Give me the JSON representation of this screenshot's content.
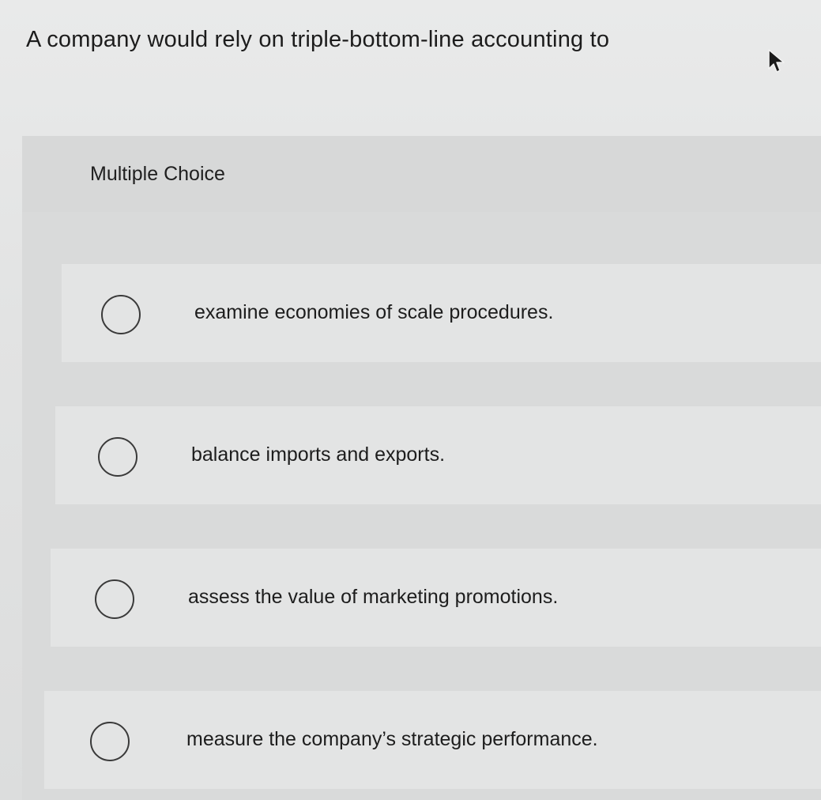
{
  "question": {
    "text": "A company would rely on triple-bottom-line accounting to"
  },
  "section": {
    "label": "Multiple Choice"
  },
  "choices": [
    {
      "label": "examine economies of scale procedures.",
      "selected": false
    },
    {
      "label": "balance imports and exports.",
      "selected": false
    },
    {
      "label": "assess the value of marketing promotions.",
      "selected": false
    },
    {
      "label": "measure the company’s strategic performance.",
      "selected": false
    }
  ],
  "icons": {
    "cursor": "mouse-pointer-icon",
    "radio": "radio-unchecked-icon"
  }
}
